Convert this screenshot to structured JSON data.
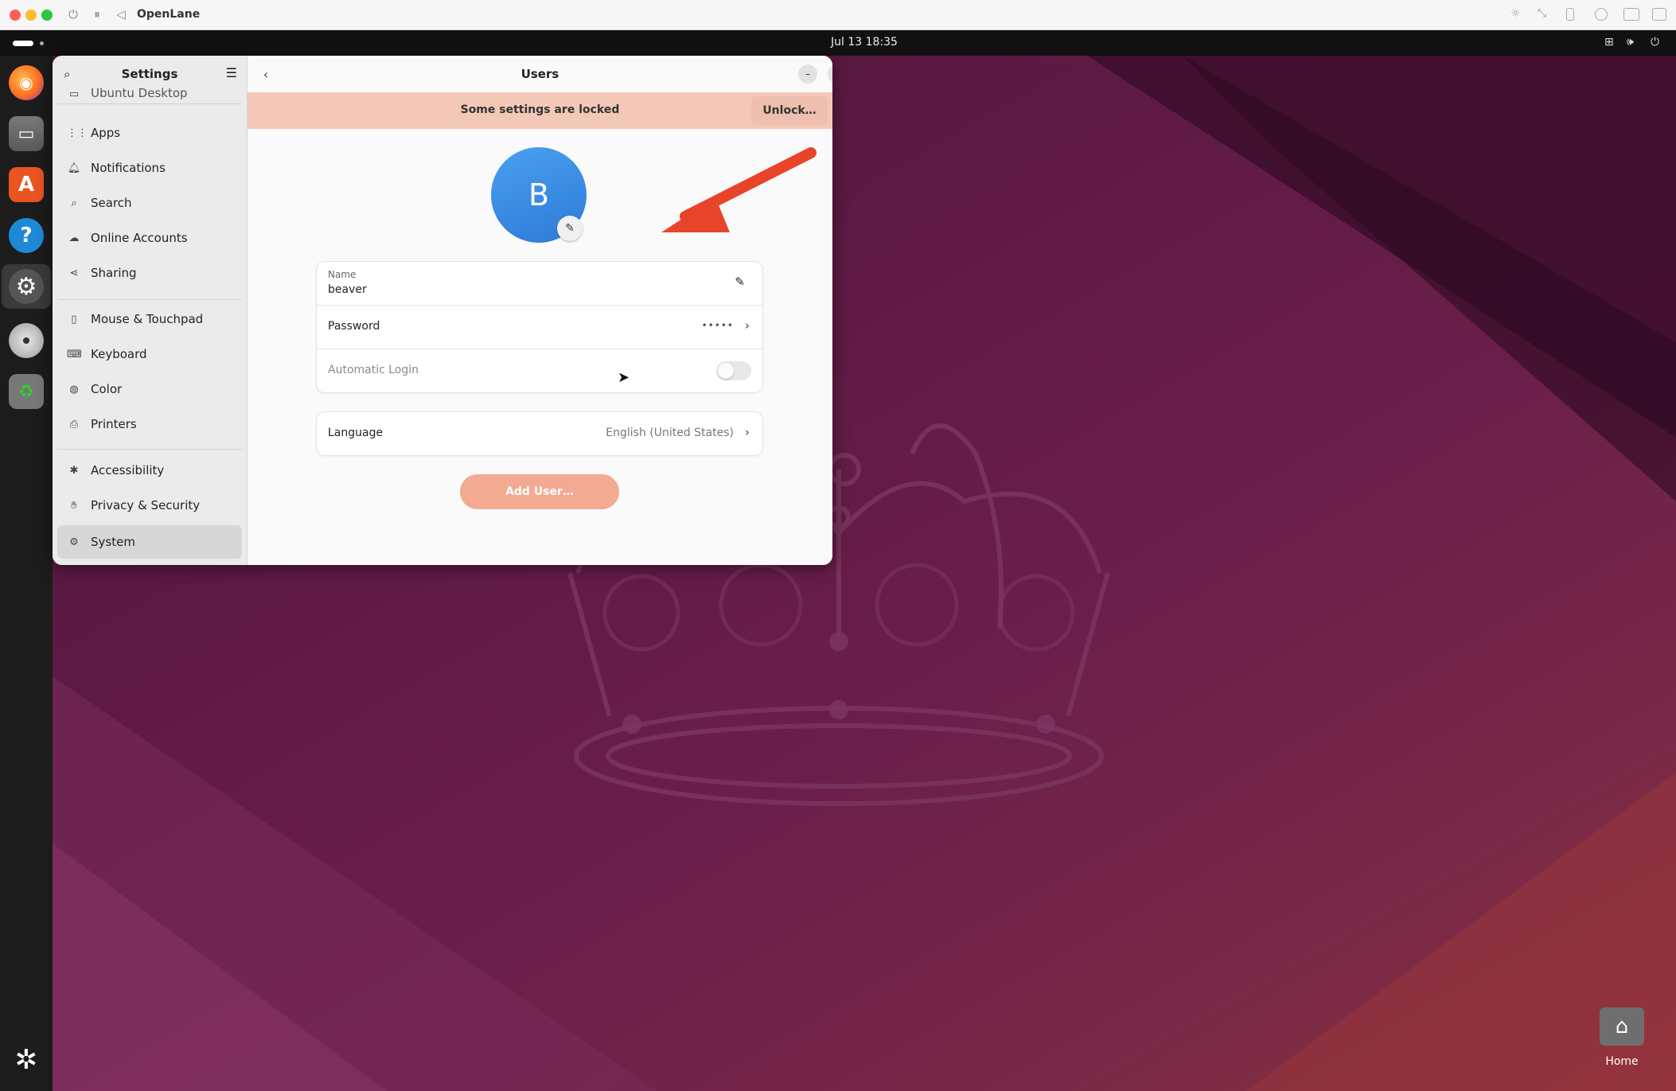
{
  "host": {
    "title": "OpenLane",
    "traffic_colors": [
      "#ff5f57",
      "#febc2e",
      "#28c840"
    ]
  },
  "topbar": {
    "clock": "Jul 13  18:35"
  },
  "dock": {
    "apps": [
      "firefox-icon",
      "files-icon",
      "app-center-icon",
      "help-icon",
      "settings-icon",
      "disc-icon",
      "trash-icon",
      "ubuntu-apps-icon"
    ]
  },
  "settings": {
    "sidebar_title": "Settings",
    "sidebar_items": [
      {
        "label": "Ubuntu Desktop"
      },
      {
        "label": "Apps"
      },
      {
        "label": "Notifications"
      },
      {
        "label": "Search"
      },
      {
        "label": "Online Accounts"
      },
      {
        "label": "Sharing"
      },
      {
        "label": "Mouse & Touchpad"
      },
      {
        "label": "Keyboard"
      },
      {
        "label": "Color"
      },
      {
        "label": "Printers"
      },
      {
        "label": "Accessibility"
      },
      {
        "label": "Privacy & Security"
      },
      {
        "label": "System"
      }
    ],
    "active_item": "System",
    "page_title": "Users",
    "banner_text": "Some settings are locked",
    "unlock_label": "Unlock…",
    "avatar_initial": "B",
    "name_caption": "Name",
    "name_value": "beaver",
    "password_label": "Password",
    "password_value": "•••••",
    "auto_login_label": "Automatic Login",
    "auto_login_enabled": false,
    "language_label": "Language",
    "language_value": "English (United States)",
    "add_user_label": "Add User…"
  },
  "desktop": {
    "home_label": "Home"
  },
  "colors": {
    "accent": "#e95420",
    "banner": "#f4c8b7",
    "avatar": "#3b8be6",
    "add_user_button": "#f2aa92",
    "annotation_arrow": "#e8442a"
  }
}
